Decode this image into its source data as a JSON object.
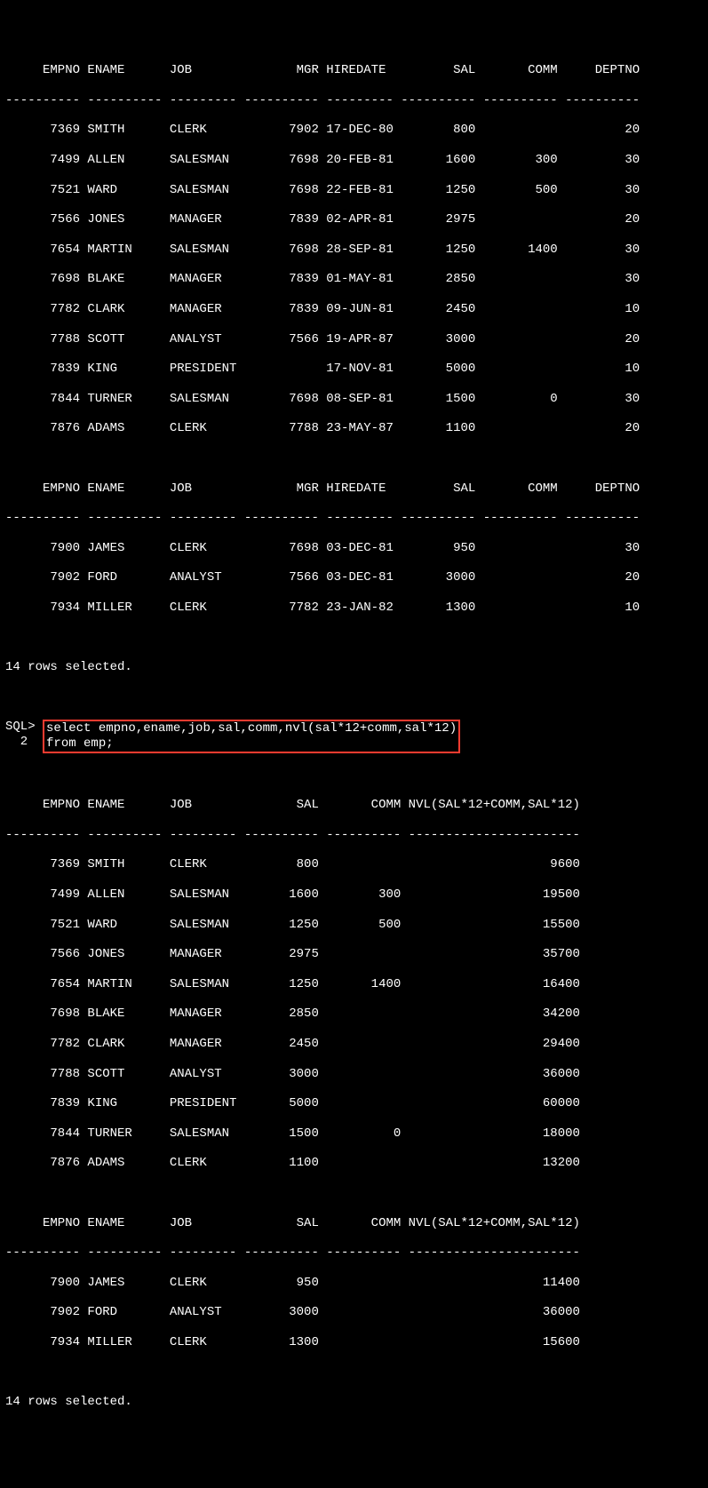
{
  "blank": " ",
  "section1": {
    "header": "     EMPNO ENAME      JOB              MGR HIREDATE         SAL       COMM     DEPTNO",
    "sep": "---------- ---------- --------- ---------- --------- ---------- ---------- ----------",
    "rows": [
      "      7369 SMITH      CLERK           7902 17-DEC-80        800                    20",
      "      7499 ALLEN      SALESMAN        7698 20-FEB-81       1600        300         30",
      "      7521 WARD       SALESMAN        7698 22-FEB-81       1250        500         30",
      "      7566 JONES      MANAGER         7839 02-APR-81       2975                    20",
      "      7654 MARTIN     SALESMAN        7698 28-SEP-81       1250       1400         30",
      "      7698 BLAKE      MANAGER         7839 01-MAY-81       2850                    30",
      "      7782 CLARK      MANAGER         7839 09-JUN-81       2450                    10",
      "      7788 SCOTT      ANALYST         7566 19-APR-87       3000                    20",
      "      7839 KING       PRESIDENT            17-NOV-81       5000                    10",
      "      7844 TURNER     SALESMAN        7698 08-SEP-81       1500          0         30",
      "      7876 ADAMS      CLERK           7788 23-MAY-87       1100                    20"
    ]
  },
  "section2": {
    "header": "     EMPNO ENAME      JOB              MGR HIREDATE         SAL       COMM     DEPTNO",
    "sep": "---------- ---------- --------- ---------- --------- ---------- ---------- ----------",
    "rows": [
      "      7900 JAMES      CLERK           7698 03-DEC-81        950                    30",
      "      7902 FORD       ANALYST         7566 03-DEC-81       3000                    20",
      "      7934 MILLER     CLERK           7782 23-JAN-82       1300                    10"
    ]
  },
  "msg1": "14 rows selected.",
  "sql": {
    "prefix1": "SQL> ",
    "prefix2": "  2  ",
    "line1": "select empno,ename,job,sal,comm,nvl(sal*12+comm,sal*12)",
    "line2": "from emp;"
  },
  "section3": {
    "header": "     EMPNO ENAME      JOB              SAL       COMM NVL(SAL*12+COMM,SAL*12)",
    "sep": "---------- ---------- --------- ---------- ---------- -----------------------",
    "rows": [
      "      7369 SMITH      CLERK            800                               9600",
      "      7499 ALLEN      SALESMAN        1600        300                   19500",
      "      7521 WARD       SALESMAN        1250        500                   15500",
      "      7566 JONES      MANAGER         2975                              35700",
      "      7654 MARTIN     SALESMAN        1250       1400                   16400",
      "      7698 BLAKE      MANAGER         2850                              34200",
      "      7782 CLARK      MANAGER         2450                              29400",
      "      7788 SCOTT      ANALYST         3000                              36000",
      "      7839 KING       PRESIDENT       5000                              60000",
      "      7844 TURNER     SALESMAN        1500          0                   18000",
      "      7876 ADAMS      CLERK           1100                              13200"
    ]
  },
  "section4": {
    "header": "     EMPNO ENAME      JOB              SAL       COMM NVL(SAL*12+COMM,SAL*12)",
    "sep": "---------- ---------- --------- ---------- ---------- -----------------------",
    "rows": [
      "      7900 JAMES      CLERK            950                              11400",
      "      7902 FORD       ANALYST         3000                              36000",
      "      7934 MILLER     CLERK           1300                              15600"
    ]
  },
  "msg2": "14 rows selected."
}
